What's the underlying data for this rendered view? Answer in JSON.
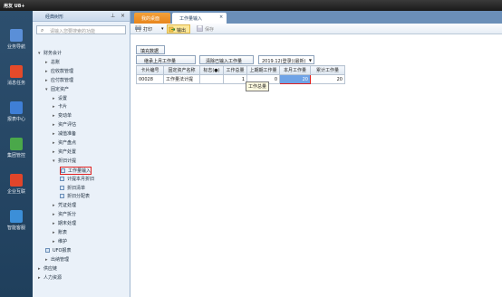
{
  "app": {
    "title": "用友 U8+"
  },
  "left_modules": [
    {
      "label": "业务导航",
      "color": "#5a8fd8"
    },
    {
      "label": "消息任务",
      "color": "#e44a2a"
    },
    {
      "label": "报表中心",
      "color": "#3f7fd6"
    },
    {
      "label": "集团管控",
      "color": "#4aa84a"
    },
    {
      "label": "企业互联",
      "color": "#e0452a"
    },
    {
      "label": "智能客服",
      "color": "#3c8fd8"
    }
  ],
  "nav": {
    "title": "经典树形",
    "search_placeholder": "请输入您要搜索的功能",
    "tree": [
      {
        "label": "财务会计",
        "arrow": "▾",
        "indent": 0
      },
      {
        "label": "总账",
        "arrow": "▸",
        "indent": 1
      },
      {
        "label": "应收款管理",
        "arrow": "▸",
        "indent": 1
      },
      {
        "label": "应付款管理",
        "arrow": "▸",
        "indent": 1
      },
      {
        "label": "固定资产",
        "arrow": "▾",
        "indent": 1
      },
      {
        "label": "设置",
        "arrow": "▸",
        "indent": 2
      },
      {
        "label": "卡片",
        "arrow": "▸",
        "indent": 2
      },
      {
        "label": "变动单",
        "arrow": "▸",
        "indent": 2
      },
      {
        "label": "资产评估",
        "arrow": "▸",
        "indent": 2
      },
      {
        "label": "减值准备",
        "arrow": "▸",
        "indent": 2
      },
      {
        "label": "资产盘点",
        "arrow": "▸",
        "indent": 2
      },
      {
        "label": "资产处置",
        "arrow": "▸",
        "indent": 2
      },
      {
        "label": "折旧计提",
        "arrow": "▾",
        "indent": 2
      },
      {
        "label": "工作量输入",
        "arrow": "",
        "indent": 3,
        "icon": true,
        "highlight": true
      },
      {
        "label": "计提本月折旧",
        "arrow": "",
        "indent": 3,
        "icon": true
      },
      {
        "label": "折旧清单",
        "arrow": "",
        "indent": 3,
        "icon": true
      },
      {
        "label": "折旧分配表",
        "arrow": "",
        "indent": 3,
        "icon": true
      },
      {
        "label": "凭证处理",
        "arrow": "▸",
        "indent": 2
      },
      {
        "label": "资产拆分",
        "arrow": "▸",
        "indent": 2
      },
      {
        "label": "期末处理",
        "arrow": "▸",
        "indent": 2
      },
      {
        "label": "账表",
        "arrow": "▸",
        "indent": 2
      },
      {
        "label": "维护",
        "arrow": "▸",
        "indent": 2
      },
      {
        "label": "UFO报表",
        "arrow": "",
        "indent": 1,
        "icon": true
      },
      {
        "label": "出纳管理",
        "arrow": "▸",
        "indent": 1
      },
      {
        "label": "供应链",
        "arrow": "▸",
        "indent": 0
      },
      {
        "label": "人力资源",
        "arrow": "▸",
        "indent": 0
      }
    ]
  },
  "tabs": {
    "home": "我的桌面",
    "active": "工作量输入"
  },
  "toolbar": {
    "print": "打印",
    "export": "输出",
    "save": "保存",
    "export_tooltip": "输出"
  },
  "form": {
    "fill_button": "填充数据",
    "inherit_button": "继承上月工作量",
    "clear_button": "清除已输入工作量",
    "period": "2019.12(登录)(最新)",
    "period_arrow": "▼"
  },
  "grid": {
    "columns": [
      "卡片编号",
      "固定资产名称",
      "标志(●)",
      "工作总量",
      "上期期工作量",
      "本月工作量",
      "累计工作量"
    ],
    "rows": [
      {
        "card_no": "00028",
        "name": "工作量法计提",
        "flag": "",
        "total": "1",
        "last_period": "0",
        "this_month": "20",
        "cumulative": "20"
      }
    ],
    "cell_tooltip": "工作总量"
  }
}
